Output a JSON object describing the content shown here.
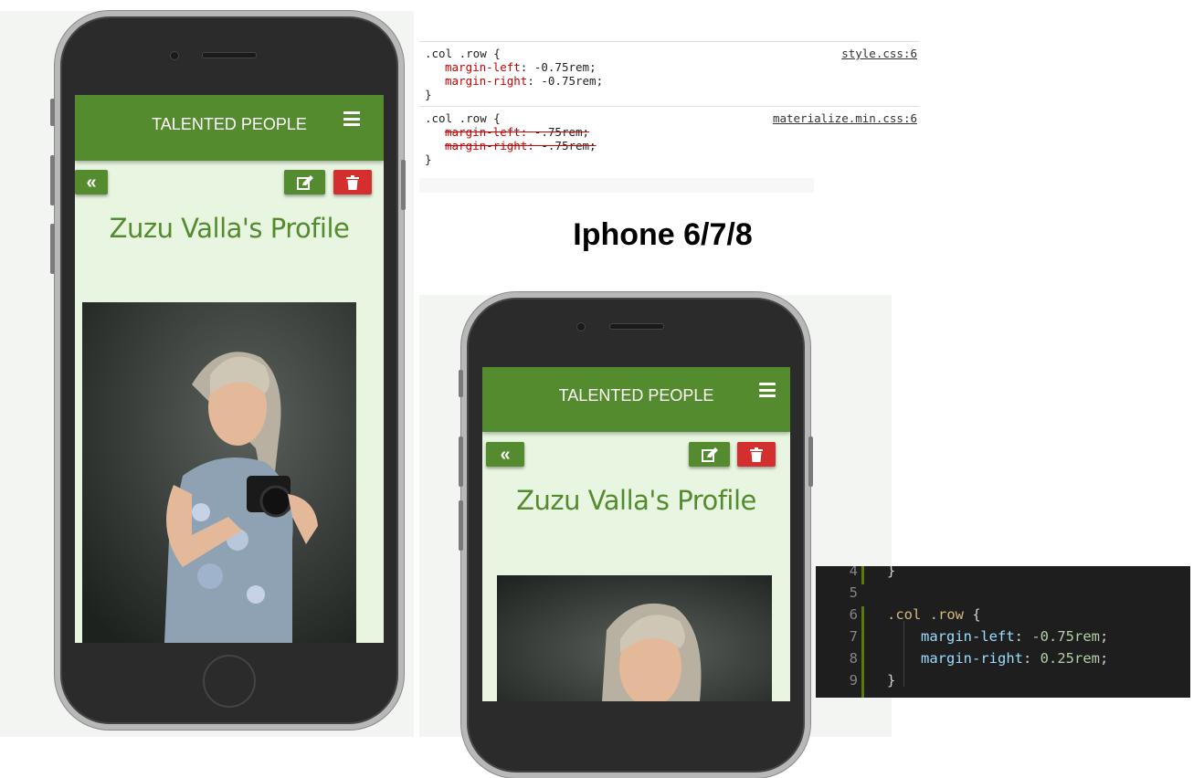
{
  "devtools": {
    "rules": [
      {
        "selector": ".col .row {",
        "source": "style.css:6",
        "declarations": [
          {
            "prop": "margin-left",
            "value": "-0.75rem;",
            "overridden": false
          },
          {
            "prop": "margin-right",
            "value": "-0.75rem;",
            "overridden": false
          }
        ],
        "close": "}"
      },
      {
        "selector": ".col .row {",
        "source": "materialize.min.css:6",
        "declarations": [
          {
            "prop": "margin-left",
            "value": "-.75rem;",
            "overridden": true
          },
          {
            "prop": "margin-right",
            "value": "-.75rem;",
            "overridden": true
          }
        ],
        "close": "}"
      }
    ]
  },
  "device_heading": "Iphone 6/7/8",
  "app": {
    "brand": "TALENTED PEOPLE",
    "back_icon": "«",
    "edit_icon": "edit-icon",
    "delete_icon": "trash-icon",
    "profile_title": "Zuzu Valla's Profile",
    "colors": {
      "primary": "#558b2f",
      "danger": "#d32f2f",
      "background": "#e8f5e1"
    }
  },
  "editor": {
    "lines": [
      {
        "num": "4",
        "code": "}"
      },
      {
        "num": "5",
        "code": ""
      },
      {
        "num": "6",
        "selector": ".col .row",
        "brace": " {"
      },
      {
        "num": "7",
        "prop": "margin-left",
        "value": "-0.75rem"
      },
      {
        "num": "8",
        "prop": "margin-right",
        "value": "0.25rem"
      },
      {
        "num": "9",
        "code": "}"
      }
    ]
  }
}
